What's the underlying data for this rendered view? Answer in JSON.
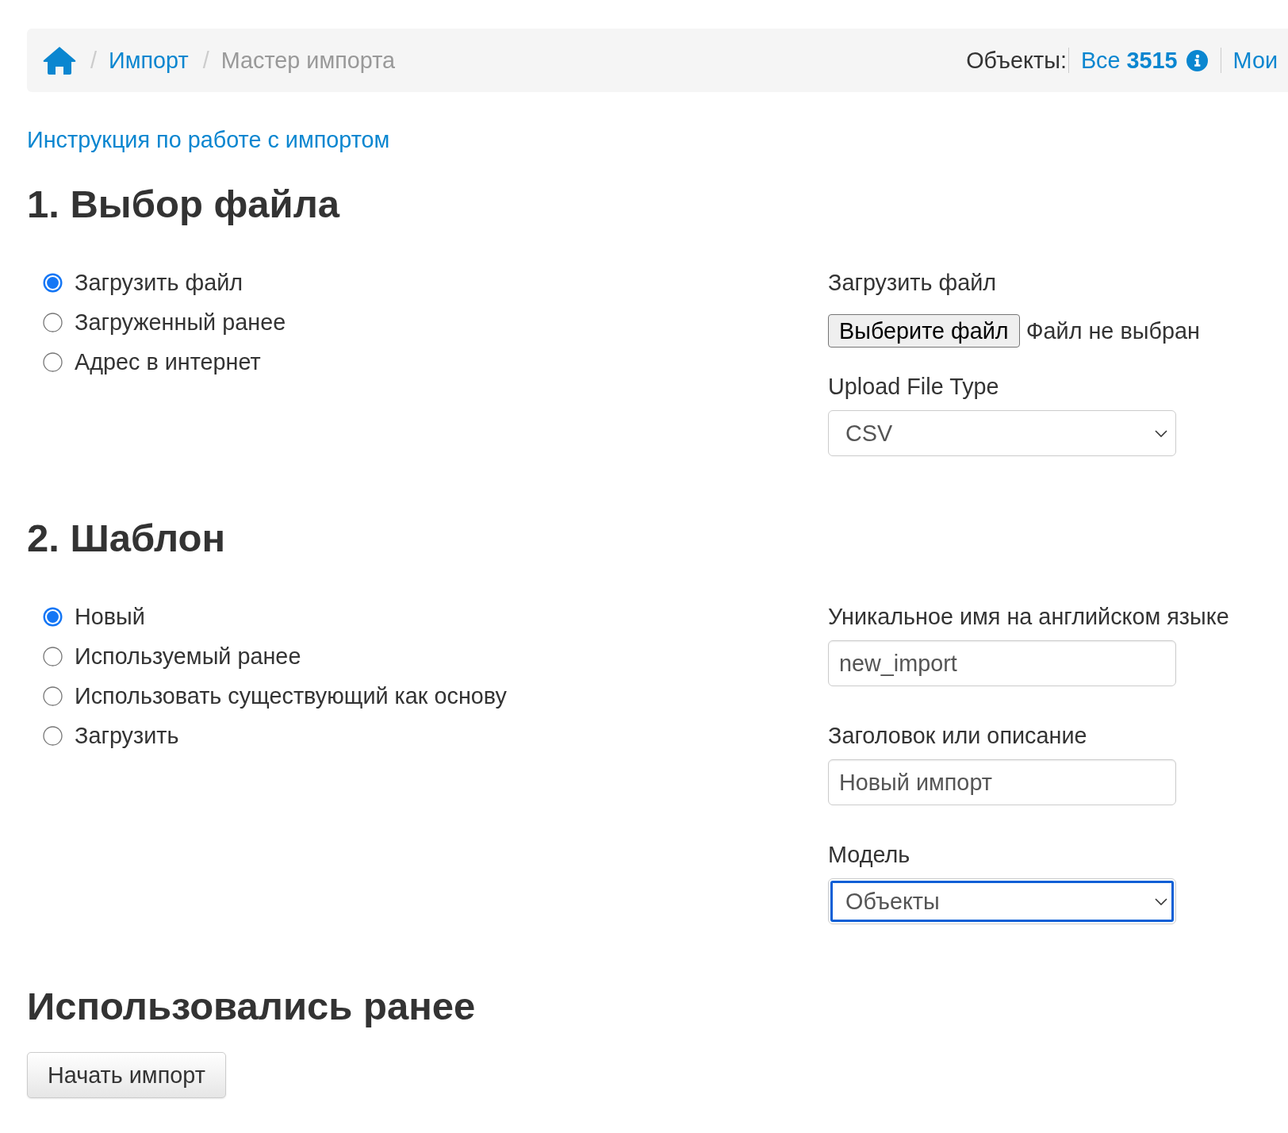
{
  "breadcrumb": {
    "items": [
      {
        "kind": "home"
      },
      {
        "kind": "link",
        "separator": "/",
        "label": "Импорт"
      },
      {
        "kind": "current",
        "separator": "/",
        "label": "Мастер импорта"
      }
    ]
  },
  "counters": {
    "label": "Объекты:",
    "links": [
      {
        "label": "Все **3515**",
        "info": true
      },
      {
        "label": "Мои",
        "info": false
      }
    ]
  },
  "help_link": "Инструкция по работе с импортом",
  "sections": [
    {
      "title": "1. Выбор файла",
      "options": [
        {
          "label": "Загрузить файл",
          "selected": true
        },
        {
          "label": "Загруженный ранее",
          "selected": false
        },
        {
          "label": "Адрес в интернет",
          "selected": false
        }
      ],
      "fields": [
        {
          "kind": "file",
          "label": "Загрузить файл",
          "button": "Выберите файл",
          "status": "Файл не выбран"
        },
        {
          "kind": "select",
          "label": "Upload File Type",
          "value": "CSV",
          "focused": false
        }
      ]
    },
    {
      "title": "2. Шаблон",
      "options": [
        {
          "label": "Новый",
          "selected": true
        },
        {
          "label": "Используемый ранее",
          "selected": false
        },
        {
          "label": "Использовать существующий как основу",
          "selected": false
        },
        {
          "label": "Загрузить",
          "selected": false
        }
      ],
      "fields": [
        {
          "kind": "text",
          "label": "Уникальное имя на английском языке",
          "value": "new_import"
        },
        {
          "kind": "text",
          "label": "Заголовок или описание",
          "value": "Новый импорт"
        },
        {
          "kind": "select",
          "label": "Модель",
          "value": "Объекты",
          "focused": true
        }
      ]
    }
  ],
  "previous": {
    "title": "Использовались ранее",
    "button": "Начать импорт"
  }
}
